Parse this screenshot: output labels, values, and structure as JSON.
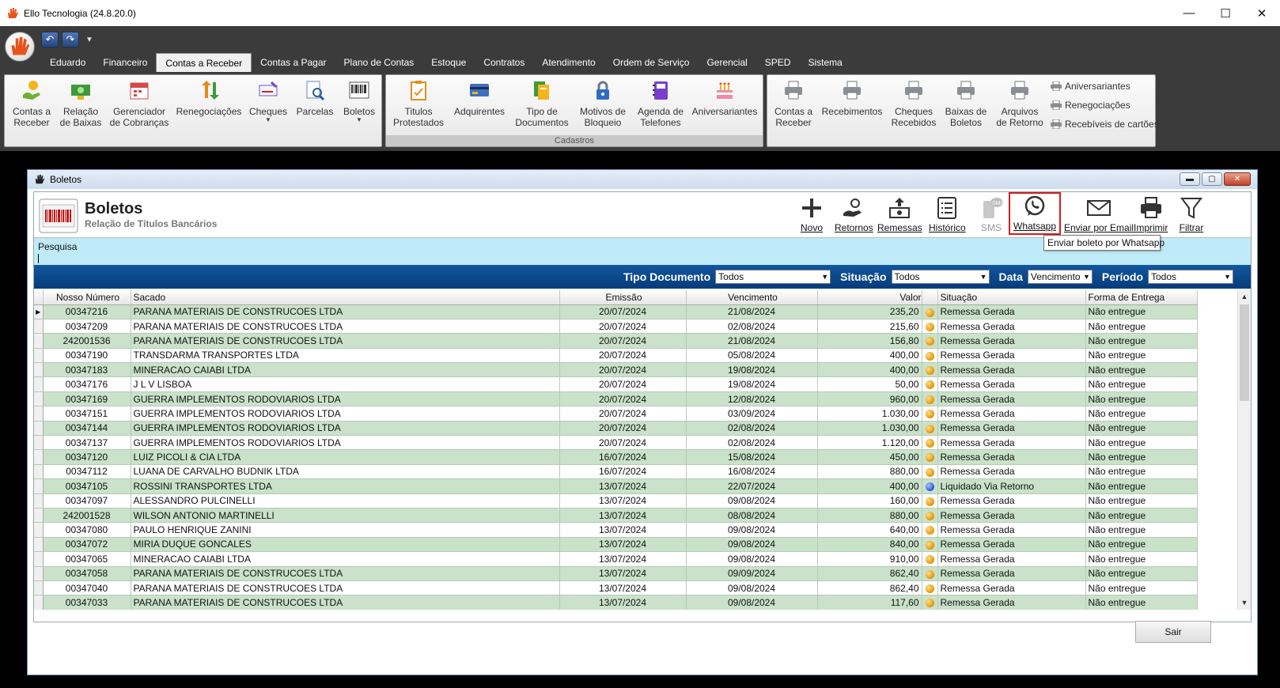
{
  "app": {
    "title": "Ello Tecnologia (24.8.20.0)"
  },
  "menu_tabs": [
    "Eduardo",
    "Financeiro",
    "Contas a Receber",
    "Contas a Pagar",
    "Plano de Contas",
    "Estoque",
    "Contratos",
    "Atendimento",
    "Ordem de Serviço",
    "Gerencial",
    "SPED",
    "Sistema"
  ],
  "active_tab": "Contas a Receber",
  "ribbon": {
    "group1": [
      {
        "l1": "Contas a",
        "l2": "Receber",
        "icon": "hand-money-icon"
      },
      {
        "l1": "Relação",
        "l2": "de Baixas",
        "icon": "cash-icon"
      },
      {
        "l1": "Gerenciador",
        "l2": "de Cobranças",
        "icon": "calendar-icon"
      },
      {
        "l1": "Renegociações",
        "l2": "",
        "icon": "exchange-icon"
      },
      {
        "l1": "Cheques",
        "l2": "",
        "icon": "check-icon"
      },
      {
        "l1": "Parcelas",
        "l2": "",
        "icon": "search-document-icon"
      },
      {
        "l1": "Boletos",
        "l2": "",
        "icon": "barcode-icon"
      }
    ],
    "group2_name": "Cadastros",
    "group2": [
      {
        "l1": "Titulos",
        "l2": "Protestados",
        "icon": "clipboard-icon"
      },
      {
        "l1": "Adquirentes",
        "l2": "",
        "icon": "credit-card-icon"
      },
      {
        "l1": "Tipo de",
        "l2": "Documentos",
        "icon": "documents-icon"
      },
      {
        "l1": "Motivos de",
        "l2": "Bloqueio",
        "icon": "lock-icon"
      },
      {
        "l1": "Agenda de",
        "l2": "Telefones",
        "icon": "phonebook-icon"
      },
      {
        "l1": "Aniversariantes",
        "l2": "",
        "icon": "cake-icon"
      }
    ],
    "group3": [
      {
        "l1": "Contas a",
        "l2": "Receber",
        "icon": "printer-icon"
      },
      {
        "l1": "Recebimentos",
        "l2": "",
        "icon": "printer-icon"
      },
      {
        "l1": "Cheques",
        "l2": "Recebidos",
        "icon": "printer-icon"
      },
      {
        "l1": "Baixas de",
        "l2": "Boletos",
        "icon": "printer-icon"
      },
      {
        "l1": "Arquivos",
        "l2": "de Retorno",
        "icon": "printer-icon"
      }
    ],
    "group3_small": [
      "Aniversariantes",
      "Renegociações",
      "Recebíveis de cartões"
    ]
  },
  "window": {
    "title": "Boletos",
    "header_title": "Boletos",
    "header_subtitle": "Relação de Títulos Bancários",
    "toolbar": {
      "novo": "Novo",
      "retornos": "Retornos",
      "remessas": "Remessas",
      "historico": "Histórico",
      "sms": "SMS",
      "whatsapp": "Whatsapp",
      "email": "Enviar por Email",
      "imprimir": "Imprimir",
      "filtrar": "Filtrar"
    },
    "tooltip": "Enviar boleto por Whatsapp",
    "search_label": "Pesquisa",
    "filters": {
      "tipo_label": "Tipo Documento",
      "tipo_value": "Todos",
      "situacao_label": "Situação",
      "situacao_value": "Todos",
      "data_label": "Data",
      "data_value": "Vencimento",
      "periodo_label": "Período",
      "periodo_value": "Todos"
    },
    "columns": [
      "Nosso Número",
      "Sacado",
      "Emissão",
      "Vencimento",
      "Valor",
      "Situação",
      "Forma de Entrega"
    ],
    "rows": [
      {
        "nosso": "00347216",
        "sacado": "PARANA MATERIAIS DE CONSTRUCOES LTDA",
        "emissao": "20/07/2024",
        "venc": "21/08/2024",
        "valor": "235,20",
        "status": "orange",
        "situacao": "Remessa Gerada",
        "entrega": "Não entregue"
      },
      {
        "nosso": "00347209",
        "sacado": "PARANA MATERIAIS DE CONSTRUCOES LTDA",
        "emissao": "20/07/2024",
        "venc": "02/08/2024",
        "valor": "215,60",
        "status": "orange",
        "situacao": "Remessa Gerada",
        "entrega": "Não entregue"
      },
      {
        "nosso": "242001536",
        "sacado": "PARANA MATERIAIS DE CONSTRUCOES LTDA",
        "emissao": "20/07/2024",
        "venc": "21/08/2024",
        "valor": "156,80",
        "status": "orange",
        "situacao": "Remessa Gerada",
        "entrega": "Não entregue"
      },
      {
        "nosso": "00347190",
        "sacado": "TRANSDARMA TRANSPORTES LTDA",
        "emissao": "20/07/2024",
        "venc": "05/08/2024",
        "valor": "400,00",
        "status": "orange",
        "situacao": "Remessa Gerada",
        "entrega": "Não entregue"
      },
      {
        "nosso": "00347183",
        "sacado": "MINERACAO CAIABI LTDA",
        "emissao": "20/07/2024",
        "venc": "19/08/2024",
        "valor": "400,00",
        "status": "orange",
        "situacao": "Remessa Gerada",
        "entrega": "Não entregue"
      },
      {
        "nosso": "00347176",
        "sacado": "J L V LISBOA",
        "emissao": "20/07/2024",
        "venc": "19/08/2024",
        "valor": "50,00",
        "status": "orange",
        "situacao": "Remessa Gerada",
        "entrega": "Não entregue"
      },
      {
        "nosso": "00347169",
        "sacado": "GUERRA IMPLEMENTOS RODOVIARIOS LTDA",
        "emissao": "20/07/2024",
        "venc": "12/08/2024",
        "valor": "960,00",
        "status": "orange",
        "situacao": "Remessa Gerada",
        "entrega": "Não entregue"
      },
      {
        "nosso": "00347151",
        "sacado": "GUERRA IMPLEMENTOS RODOVIARIOS LTDA",
        "emissao": "20/07/2024",
        "venc": "03/09/2024",
        "valor": "1.030,00",
        "status": "orange",
        "situacao": "Remessa Gerada",
        "entrega": "Não entregue"
      },
      {
        "nosso": "00347144",
        "sacado": "GUERRA IMPLEMENTOS RODOVIARIOS LTDA",
        "emissao": "20/07/2024",
        "venc": "02/08/2024",
        "valor": "1.030,00",
        "status": "orange",
        "situacao": "Remessa Gerada",
        "entrega": "Não entregue"
      },
      {
        "nosso": "00347137",
        "sacado": "GUERRA IMPLEMENTOS RODOVIARIOS LTDA",
        "emissao": "20/07/2024",
        "venc": "02/08/2024",
        "valor": "1.120,00",
        "status": "orange",
        "situacao": "Remessa Gerada",
        "entrega": "Não entregue"
      },
      {
        "nosso": "00347120",
        "sacado": "LUIZ PICOLI & CIA LTDA",
        "emissao": "16/07/2024",
        "venc": "15/08/2024",
        "valor": "450,00",
        "status": "orange",
        "situacao": "Remessa Gerada",
        "entrega": "Não entregue"
      },
      {
        "nosso": "00347112",
        "sacado": "LUANA DE CARVALHO BUDNIK LTDA",
        "emissao": "16/07/2024",
        "venc": "16/08/2024",
        "valor": "880,00",
        "status": "orange",
        "situacao": "Remessa Gerada",
        "entrega": "Não entregue"
      },
      {
        "nosso": "00347105",
        "sacado": "ROSSINI TRANSPORTES LTDA",
        "emissao": "13/07/2024",
        "venc": "22/07/2024",
        "valor": "400,00",
        "status": "blue",
        "situacao": "Liquidado Via Retorno",
        "entrega": "Não entregue"
      },
      {
        "nosso": "00347097",
        "sacado": "ALESSANDRO PULCINELLI",
        "emissao": "13/07/2024",
        "venc": "09/08/2024",
        "valor": "160,00",
        "status": "orange",
        "situacao": "Remessa Gerada",
        "entrega": "Não entregue"
      },
      {
        "nosso": "242001528",
        "sacado": "WILSON ANTONIO MARTINELLI",
        "emissao": "13/07/2024",
        "venc": "08/08/2024",
        "valor": "880,00",
        "status": "orange",
        "situacao": "Remessa Gerada",
        "entrega": "Não entregue"
      },
      {
        "nosso": "00347080",
        "sacado": "PAULO HENRIQUE ZANINI",
        "emissao": "13/07/2024",
        "venc": "09/08/2024",
        "valor": "640,00",
        "status": "orange",
        "situacao": "Remessa Gerada",
        "entrega": "Não entregue"
      },
      {
        "nosso": "00347072",
        "sacado": "MIRIA DUQUE GONCALES",
        "emissao": "13/07/2024",
        "venc": "09/08/2024",
        "valor": "840,00",
        "status": "orange",
        "situacao": "Remessa Gerada",
        "entrega": "Não entregue"
      },
      {
        "nosso": "00347065",
        "sacado": "MINERACAO CAIABI LTDA",
        "emissao": "13/07/2024",
        "venc": "09/08/2024",
        "valor": "910,00",
        "status": "orange",
        "situacao": "Remessa Gerada",
        "entrega": "Não entregue"
      },
      {
        "nosso": "00347058",
        "sacado": "PARANA MATERIAIS DE CONSTRUCOES LTDA",
        "emissao": "13/07/2024",
        "venc": "09/09/2024",
        "valor": "862,40",
        "status": "orange",
        "situacao": "Remessa Gerada",
        "entrega": "Não entregue"
      },
      {
        "nosso": "00347040",
        "sacado": "PARANA MATERIAIS DE CONSTRUCOES LTDA",
        "emissao": "13/07/2024",
        "venc": "09/08/2024",
        "valor": "862,40",
        "status": "orange",
        "situacao": "Remessa Gerada",
        "entrega": "Não entregue"
      },
      {
        "nosso": "00347033",
        "sacado": "PARANA MATERIAIS DE CONSTRUCOES LTDA",
        "emissao": "13/07/2024",
        "venc": "09/08/2024",
        "valor": "117,60",
        "status": "orange",
        "situacao": "Remessa Gerada",
        "entrega": "Não entregue"
      }
    ],
    "close_button": "Sair"
  },
  "colors": {
    "accent_blue": "#0a4a8e",
    "row_green": "#c9e2c9",
    "highlight_red": "#d21e1e",
    "tooltip_border": "#767676"
  }
}
